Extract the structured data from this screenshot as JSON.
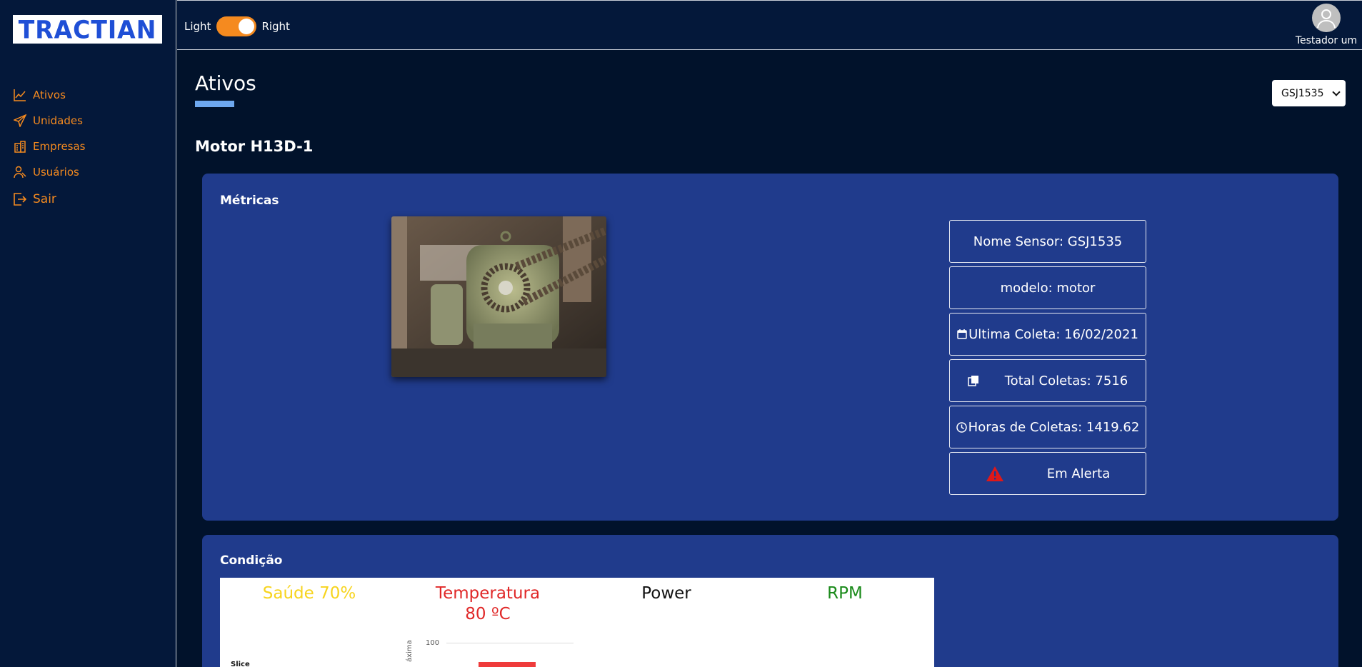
{
  "brand": {
    "logo_text": "TRACTIAN"
  },
  "theme_toggle": {
    "left_label": "Light",
    "right_label": "Right",
    "state": "on",
    "accent": "#f58a1f"
  },
  "user": {
    "name": "Testador um"
  },
  "sidebar": {
    "items": [
      {
        "label": "Ativos",
        "icon": "chart-line-icon"
      },
      {
        "label": "Unidades",
        "icon": "send-icon"
      },
      {
        "label": "Empresas",
        "icon": "building-icon"
      },
      {
        "label": "Usuários",
        "icon": "user-icon"
      },
      {
        "label": "Sair",
        "icon": "logout-icon"
      }
    ]
  },
  "page": {
    "title": "Ativos",
    "asset_name": "Motor H13D-1"
  },
  "sensor_select": {
    "selected": "GSJ1535"
  },
  "metricas": {
    "title": "Métricas",
    "photo_alt": "motor",
    "info": [
      {
        "text": "Nome Sensor: GSJ1535",
        "icon": ""
      },
      {
        "text": "modelo: motor",
        "icon": ""
      },
      {
        "text": "Ultima Coleta: 16/02/2021",
        "icon": "calendar-icon"
      },
      {
        "text": "Total Coletas: 7516",
        "icon": "copy-icon"
      },
      {
        "text": "Horas de Coletas: 1419.62",
        "icon": "clock-icon"
      },
      {
        "text": "Em Alerta",
        "icon": "warning-icon"
      }
    ]
  },
  "condicao": {
    "title": "Condição",
    "cards": [
      {
        "label": "Saúde 70%",
        "color": "#f7d41e"
      },
      {
        "label": "Temperatura",
        "label2": "80 ºC",
        "color": "#e02828"
      },
      {
        "label": "Power",
        "color": "#111111"
      },
      {
        "label": "RPM",
        "color": "#1a8a1a"
      }
    ],
    "mini_texts": {
      "slice": "Slice",
      "tick_100": "100",
      "axis_label": "áxima"
    }
  }
}
